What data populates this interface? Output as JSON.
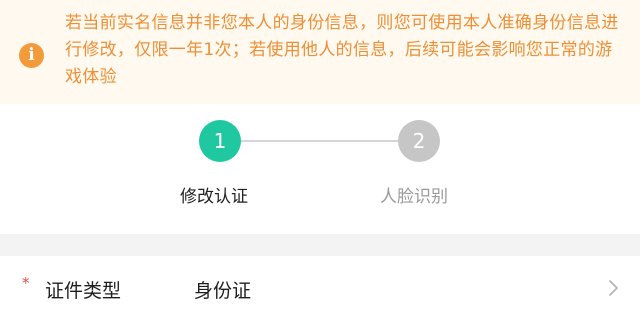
{
  "notice": {
    "icon": "info-icon",
    "icon_glyph": "i",
    "text": "若当前实名信息并非您本人的身份信息，则您可使用本人准确身份信息进行修改，仅限一年1次；若使用他人的信息，后续可能会影响您正常的游戏体验",
    "color": "#ee8f36",
    "background": "#fff9ef"
  },
  "steps": [
    {
      "number": "1",
      "label": "修改认证",
      "state": "active",
      "color": "#1fc8a0"
    },
    {
      "number": "2",
      "label": "人脸识别",
      "state": "inactive",
      "color": "#c6c6c6"
    }
  ],
  "form": {
    "fields": [
      {
        "required_mark": "*",
        "label": "证件类型",
        "value": "身份证",
        "trailing_icon": "chevron-right-icon"
      }
    ]
  }
}
